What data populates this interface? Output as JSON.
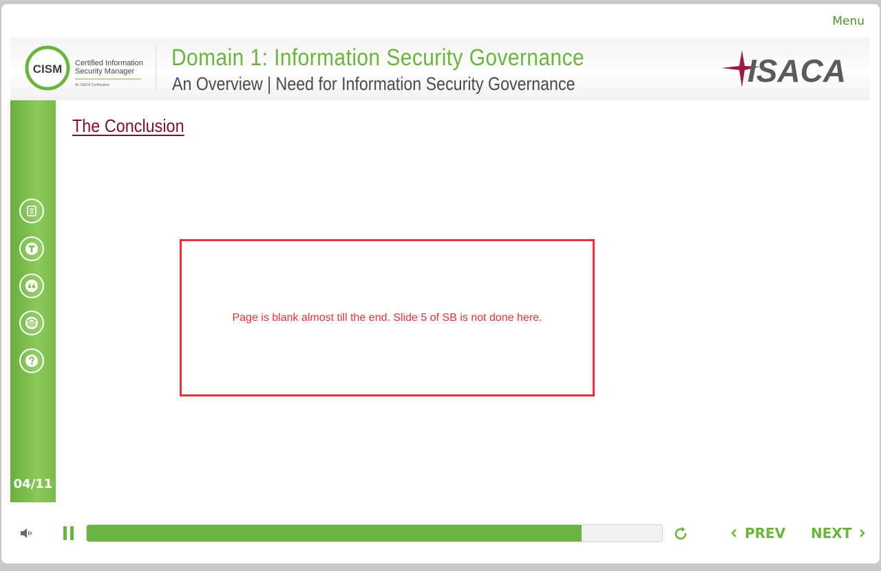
{
  "menu": {
    "label": "Menu"
  },
  "header": {
    "logo_left": {
      "acronym": "CISM",
      "line1": "Certified Information",
      "line2": "Security Manager",
      "tag": "An ISACA Certification"
    },
    "title": "Domain 1: Information Security Governance",
    "subtitle": "An Overview | Need for Information Security Governance",
    "logo_right": {
      "name": "ISACA"
    }
  },
  "sidebar": {
    "icons": [
      "notes-icon",
      "transcript-icon",
      "quote-icon",
      "layers-icon",
      "help-icon"
    ],
    "counter": "04/11"
  },
  "slide": {
    "title": "The Conclusion",
    "note": "Page is blank almost till the end. Slide 5 of SB is not done here."
  },
  "controls": {
    "progress_percent": 86,
    "prev_label": "PREV",
    "next_label": "NEXT"
  },
  "colors": {
    "accent": "#6cb33f",
    "title": "#7b1033",
    "note": "#e2303b"
  }
}
